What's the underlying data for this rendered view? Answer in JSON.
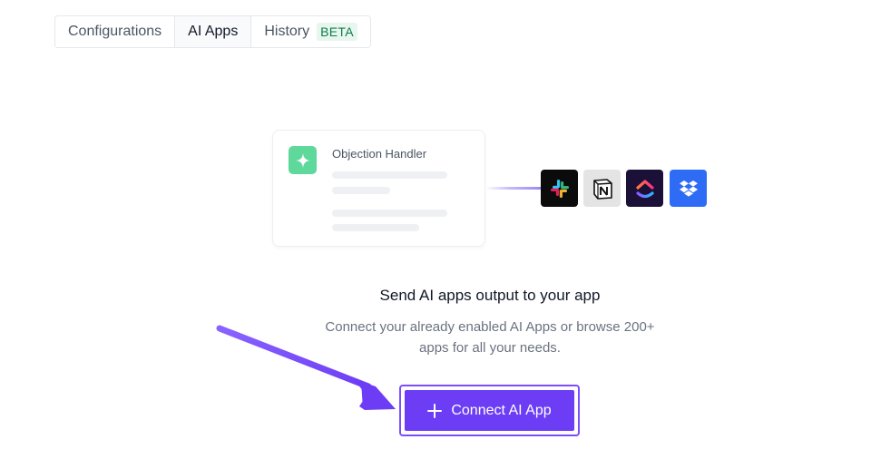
{
  "tabs": [
    {
      "label": "Configurations",
      "active": false
    },
    {
      "label": "AI Apps",
      "active": true
    },
    {
      "label": "History",
      "active": false,
      "badge": "BETA"
    }
  ],
  "illustration": {
    "card_title": "Objection Handler",
    "card_icon": "sparkle-icon",
    "apps": [
      "slack-icon",
      "notion-icon",
      "clickup-icon",
      "dropbox-icon"
    ]
  },
  "main": {
    "heading": "Send AI apps output to your app",
    "description_line1": "Connect your already enabled AI Apps or browse 200+",
    "description_line2": "apps for all your needs.",
    "button_label": "Connect AI App",
    "button_icon": "plus-icon"
  },
  "colors": {
    "accent": "#6d3df5",
    "accent_outline": "#7c4dff",
    "card_icon_bg": "#5fd89b",
    "beta_bg": "#e7f7ef",
    "beta_text": "#0f7a4a"
  }
}
